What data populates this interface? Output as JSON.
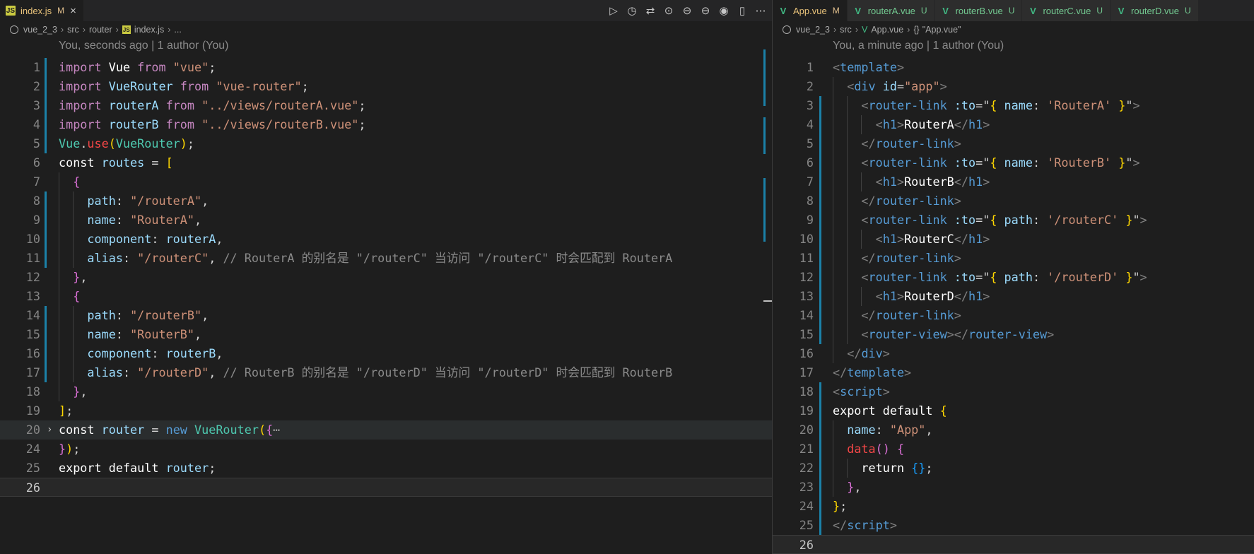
{
  "left": {
    "tab": {
      "name": "index.js",
      "status": "M",
      "close": "×"
    },
    "actions": [
      "▷",
      "◷",
      "⇄",
      "⊙",
      "⊖",
      "⊖",
      "◉",
      "▯",
      "⋯"
    ],
    "breadcrumb": [
      "vue_2_3",
      "src",
      "router",
      "index.js",
      "..."
    ],
    "blame": "You, seconds ago | 1 author (You)",
    "line_numbers": [
      "1",
      "2",
      "3",
      "4",
      "5",
      "6",
      "7",
      "8",
      "9",
      "10",
      "11",
      "12",
      "13",
      "14",
      "15",
      "16",
      "17",
      "18",
      "19",
      "20",
      "24",
      "25",
      "26"
    ],
    "code": {
      "l1": [
        "import",
        "Vue",
        "from",
        "\"vue\"",
        ";"
      ],
      "l2": [
        "import",
        "VueRouter",
        "from",
        "\"vue-router\"",
        ";"
      ],
      "l3": [
        "import",
        "routerA",
        "from",
        "\"../views/routerA.vue\"",
        ";"
      ],
      "l4": [
        "import",
        "routerB",
        "from",
        "\"../views/routerB.vue\"",
        ";"
      ],
      "l5": [
        "Vue",
        ".",
        "use",
        "(",
        "VueRouter",
        ")",
        ";"
      ],
      "l6": [
        "const",
        "routes",
        "=",
        "["
      ],
      "l7": [
        "{"
      ],
      "l8": [
        "path",
        ":",
        "\"/routerA\"",
        ","
      ],
      "l9": [
        "name",
        ":",
        "\"RouterA\"",
        ","
      ],
      "l10": [
        "component",
        ":",
        "routerA",
        ","
      ],
      "l11": [
        "alias",
        ":",
        "\"/routerC\"",
        ",",
        "// RouterA 的别名是 \"/routerC\" 当访问 \"/routerC\" 时会匹配到 RouterA"
      ],
      "l12": [
        "}",
        ","
      ],
      "l13": [
        "{"
      ],
      "l14": [
        "path",
        ":",
        "\"/routerB\"",
        ","
      ],
      "l15": [
        "name",
        ":",
        "\"RouterB\"",
        ","
      ],
      "l16": [
        "component",
        ":",
        "routerB",
        ","
      ],
      "l17": [
        "alias",
        ":",
        "\"/routerD\"",
        ",",
        "// RouterB 的别名是 \"/routerD\" 当访问 \"/routerD\" 时会匹配到 RouterB"
      ],
      "l18": [
        "}",
        ","
      ],
      "l19": [
        "]",
        ";"
      ],
      "l20": [
        "const",
        "router",
        "=",
        "new",
        "VueRouter",
        "(",
        "{",
        "⋯"
      ],
      "l24": [
        "}",
        ")",
        ";"
      ],
      "l25": [
        "export",
        "default",
        "router",
        ";"
      ]
    }
  },
  "right": {
    "tabs": [
      {
        "name": "App.vue",
        "status": "M"
      },
      {
        "name": "routerA.vue",
        "status": "U"
      },
      {
        "name": "routerB.vue",
        "status": "U"
      },
      {
        "name": "routerC.vue",
        "status": "U"
      },
      {
        "name": "routerD.vue",
        "status": "U"
      }
    ],
    "breadcrumb": [
      "vue_2_3",
      "src",
      "App.vue",
      "\"App.vue\""
    ],
    "blame": "You, a minute ago | 1 author (You)",
    "line_numbers": [
      "1",
      "2",
      "3",
      "4",
      "5",
      "6",
      "7",
      "8",
      "9",
      "10",
      "11",
      "12",
      "13",
      "14",
      "15",
      "16",
      "17",
      "18",
      "19",
      "20",
      "21",
      "22",
      "23",
      "24",
      "25",
      "26"
    ],
    "code": {
      "l1": [
        "<",
        "template",
        ">"
      ],
      "l2": [
        "<",
        "div",
        "id",
        "=",
        "\"app\"",
        ">"
      ],
      "l3": [
        "<",
        "router-link",
        ":to",
        "=\"",
        "{",
        "name",
        ":",
        "'RouterA'",
        "}",
        "\"",
        ">"
      ],
      "l4": [
        "<",
        "h1",
        ">",
        "RouterA",
        "</",
        "h1",
        ">"
      ],
      "l5": [
        "</",
        "router-link",
        ">"
      ],
      "l6": [
        "<",
        "router-link",
        ":to",
        "=\"",
        "{",
        "name",
        ":",
        "'RouterB'",
        "}",
        "\"",
        ">"
      ],
      "l7": [
        "<",
        "h1",
        ">",
        "RouterB",
        "</",
        "h1",
        ">"
      ],
      "l8": [
        "</",
        "router-link",
        ">"
      ],
      "l9": [
        "<",
        "router-link",
        ":to",
        "=\"",
        "{",
        "path",
        ":",
        "'/routerC'",
        "}",
        "\"",
        ">"
      ],
      "l10": [
        "<",
        "h1",
        ">",
        "RouterC",
        "</",
        "h1",
        ">"
      ],
      "l11": [
        "</",
        "router-link",
        ">"
      ],
      "l12": [
        "<",
        "router-link",
        ":to",
        "=\"",
        "{",
        "path",
        ":",
        "'/routerD'",
        "}",
        "\"",
        ">"
      ],
      "l13": [
        "<",
        "h1",
        ">",
        "RouterD",
        "</",
        "h1",
        ">"
      ],
      "l14": [
        "</",
        "router-link",
        ">"
      ],
      "l15": [
        "<",
        "router-view",
        ">",
        "</",
        "router-view",
        ">"
      ],
      "l16": [
        "</",
        "div",
        ">"
      ],
      "l17": [
        "</",
        "template",
        ">"
      ],
      "l18": [
        "<",
        "script",
        ">"
      ],
      "l19": [
        "export",
        "default",
        "{"
      ],
      "l20": [
        "name",
        ":",
        "\"App\"",
        ","
      ],
      "l21": [
        "data",
        "(",
        ")",
        "{"
      ],
      "l22": [
        "return",
        "{",
        "}",
        ";"
      ],
      "l23": [
        "}",
        ","
      ],
      "l24": [
        "}",
        ";"
      ],
      "l25": [
        "</",
        "script",
        ">"
      ]
    }
  },
  "colors": {
    "keyword": "#c586c0",
    "string": "#ce9178",
    "variable": "#9cdcfe",
    "type": "#4ec9b0",
    "comment": "#8a8a8a",
    "modified_marker": "#1b81a8"
  }
}
